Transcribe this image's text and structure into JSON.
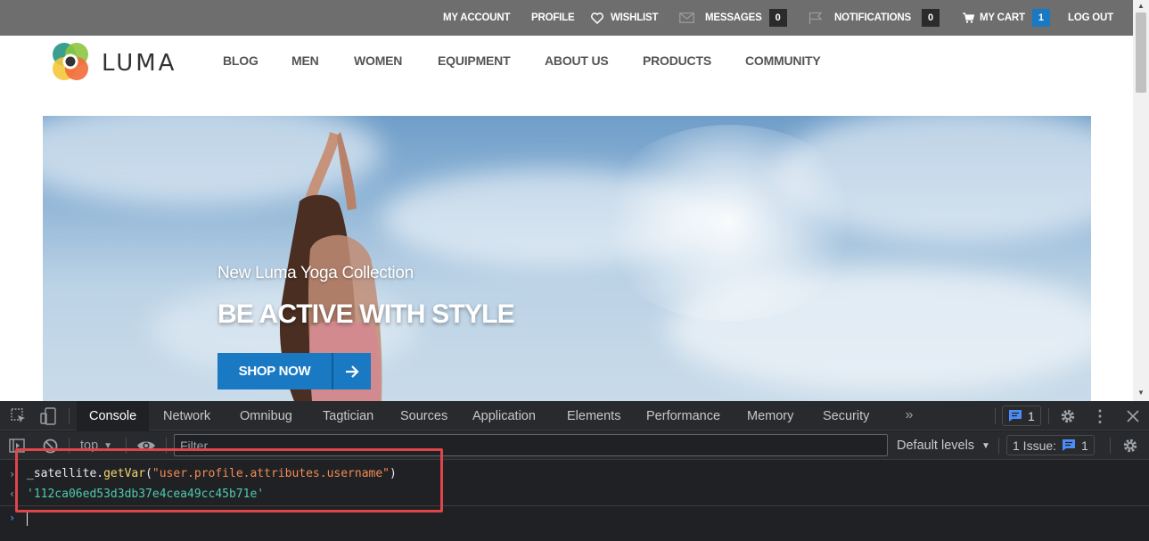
{
  "topbar": {
    "my_account": "MY ACCOUNT",
    "profile": "PROFILE",
    "wishlist": "WISHLIST",
    "messages": "MESSAGES",
    "messages_count": "0",
    "notifications": "NOTIFICATIONS",
    "notifications_count": "0",
    "my_cart": "MY CART",
    "cart_count": "1",
    "log_out": "LOG OUT"
  },
  "logo": {
    "text": "LUMA"
  },
  "nav": {
    "items": [
      "BLOG",
      "MEN",
      "WOMEN",
      "EQUIPMENT",
      "ABOUT US",
      "PRODUCTS",
      "COMMUNITY"
    ]
  },
  "hero": {
    "subtitle": "New Luma Yoga Collection",
    "title": "BE ACTIVE WITH STYLE",
    "cta": "SHOP NOW"
  },
  "devtools": {
    "tabs": [
      "Console",
      "Network",
      "Omnibug",
      "Tagtician",
      "Sources",
      "Application",
      "Elements",
      "Performance",
      "Memory",
      "Security"
    ],
    "active_tab": "Console",
    "messages_badge": "1",
    "context": "top",
    "filter_placeholder": "Filter",
    "levels": "Default levels",
    "issues_label": "1 Issue:",
    "issues_count": "1",
    "console": {
      "input_object": "_satellite",
      "input_dot": ".",
      "input_method": "getVar",
      "input_open": "(",
      "input_arg": "\"user.profile.attributes.username\"",
      "input_close": ")",
      "output": "'112ca06ed53d3db37e4cea49cc45b71e'"
    }
  },
  "colors": {
    "topbar_bg": "#6e6e6e",
    "brand_blue": "#1979c3",
    "devtools_bg": "#202124",
    "highlight": "#e0454a"
  }
}
